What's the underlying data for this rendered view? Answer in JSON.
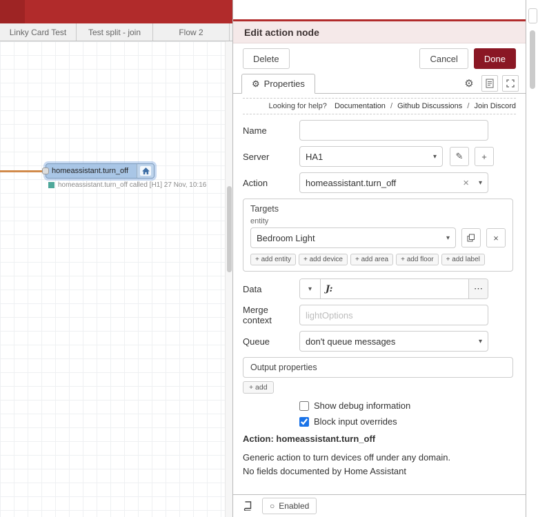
{
  "colors": {
    "header_red": "#b12b2b",
    "done_button": "#8a1724",
    "node_fill": "#a9c6e6",
    "wire": "#d18a4a",
    "status_dot": "#4ea89a",
    "checkbox_accent": "#1a73e8"
  },
  "icons": {
    "gear": "⚙",
    "pencil": "✎",
    "plus": "+",
    "close": "×",
    "chevron_down": "▾",
    "ellipsis": "⋯",
    "circle": "○"
  },
  "workspace": {
    "tabs": [
      {
        "label": "Linky Card Test"
      },
      {
        "label": "Test split - join"
      },
      {
        "label": "Flow 2"
      }
    ],
    "node": {
      "label": "homeassistant.turn_off",
      "status": "homeassistant.turn_off called [H1] 27 Nov, 10:16"
    }
  },
  "tray": {
    "title": "Edit action node",
    "toolbar": {
      "delete": "Delete",
      "cancel": "Cancel",
      "done": "Done"
    },
    "tab_properties": "Properties",
    "help": {
      "prefix": "Looking for help?",
      "separator": "/",
      "links": [
        "Documentation",
        "Github Discussions",
        "Join Discord"
      ]
    },
    "form": {
      "name": {
        "label": "Name",
        "value": ""
      },
      "server": {
        "label": "Server",
        "value": "HA1"
      },
      "action": {
        "label": "Action",
        "value": "homeassistant.turn_off"
      },
      "targets": {
        "title": "Targets",
        "entity_label": "entity",
        "entity_value": "Bedroom Light",
        "add_buttons": [
          "+ add entity",
          "+ add device",
          "+ add area",
          "+ add floor",
          "+ add label"
        ]
      },
      "data": {
        "label": "Data",
        "type_indicator": "J:"
      },
      "merge_context": {
        "label": "Merge context",
        "placeholder": "lightOptions"
      },
      "queue": {
        "label": "Queue",
        "value": "don't queue messages"
      },
      "output_properties": {
        "title": "Output properties",
        "add_button": "+ add"
      },
      "debug_checkbox": {
        "label": "Show debug information",
        "checked": false
      },
      "override_checkbox": {
        "label": "Block input overrides",
        "checked": true
      },
      "action_heading": "Action: homeassistant.turn_off",
      "description": [
        "Generic action to turn devices off under any domain.",
        "No fields documented by Home Assistant"
      ]
    },
    "footer": {
      "enabled": "Enabled"
    }
  }
}
